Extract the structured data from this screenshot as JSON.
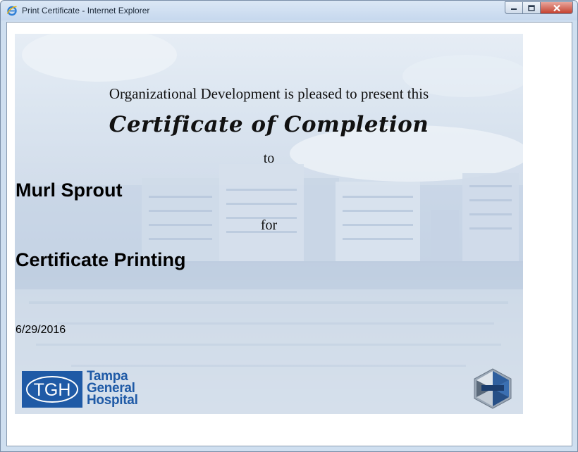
{
  "window": {
    "title": "Print Certificate - Internet Explorer"
  },
  "certificate": {
    "intro": "Organizational Development is pleased to present this",
    "heading": "Certificate of Completion",
    "to_label": "to",
    "recipient": "Murl Sprout",
    "for_label": "for",
    "course": "Certificate Printing",
    "date": "6/29/2016"
  },
  "logo": {
    "abbr": "TGH",
    "line1": "Tampa",
    "line2": "General",
    "line3": "Hospital"
  },
  "colors": {
    "brand_blue": "#1f5aa6",
    "close_red": "#c4412f"
  },
  "icons": {
    "app": "internet-explorer-icon",
    "minimize": "minimize-icon",
    "maximize": "maximize-icon",
    "close": "close-icon",
    "emblem": "framework-emblem-icon"
  }
}
